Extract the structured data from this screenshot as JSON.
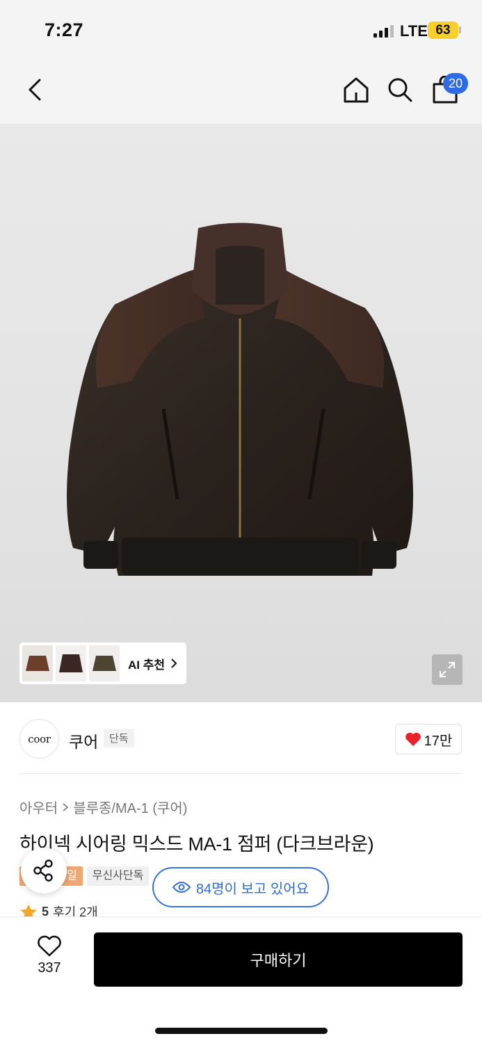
{
  "status_bar": {
    "time": "7:27",
    "network": "LTE",
    "battery": "63"
  },
  "header": {
    "cart_count": "20"
  },
  "gallery": {
    "ai_recommend_label": "AI 추천",
    "thumbnails": [
      "brown-jacket",
      "dark-fur-jacket",
      "olive-jacket"
    ]
  },
  "brand": {
    "logo_text": "coor",
    "name": "쿠어",
    "tag": "단독",
    "likes": "17만"
  },
  "product": {
    "breadcrumb": [
      "아우터",
      "블루종/MA-1 (쿠어)"
    ],
    "title": "하이넥 시어링 믹스드 MA-1 점퍼 (다크브라운)",
    "tags": [
      "일",
      "무신사단독"
    ],
    "rating": "5",
    "reviews": "후기 2개",
    "viewers": "84명이 보고 있어요"
  },
  "bottom_bar": {
    "wish_count": "337",
    "buy_label": "구매하기"
  },
  "colors": {
    "accent_blue": "#2f6be4",
    "heart_red": "#e8232b",
    "battery_yellow": "#f7ce2a"
  }
}
